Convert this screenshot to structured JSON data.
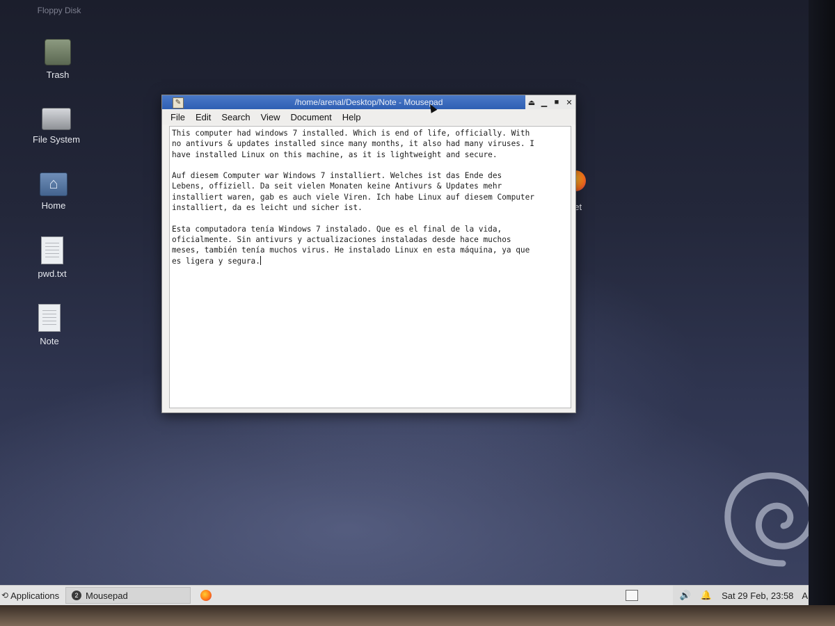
{
  "desktop": {
    "floppy_label": "Floppy Disk",
    "icons": [
      {
        "label": "Trash",
        "icon": "trash-icon"
      },
      {
        "label": "File System",
        "icon": "drive-icon"
      },
      {
        "label": "Home",
        "icon": "home-folder-icon"
      },
      {
        "label": "pwd.txt",
        "icon": "text-file-icon"
      },
      {
        "label": "Note",
        "icon": "text-file-icon"
      }
    ],
    "firefox_partial_label": "net"
  },
  "window": {
    "title": "/home/arenal/Desktop/Note - Mousepad",
    "menu": [
      "File",
      "Edit",
      "Search",
      "View",
      "Document",
      "Help"
    ],
    "content": "This computer had windows 7 installed. Which is end of life, officially. With\nno antivurs & updates installed since many months, it also had many viruses. I\nhave installed Linux on this machine, as it is lightweight and secure.\n\nAuf diesem Computer war Windows 7 installiert. Welches ist das Ende des\nLebens, offiziell. Da seit vielen Monaten keine Antivurs & Updates mehr\ninstalliert waren, gab es auch viele Viren. Ich habe Linux auf diesem Computer\ninstalliert, da es leicht und sicher ist.\n\nEsta computadora tenía Windows 7 instalado. Que es el final de la vida,\noficialmente. Sin antivurs y actualizaciones instaladas desde hace muchos\nmeses, también tenía muchos virus. He instalado Linux en esta máquina, ya que\nes ligera y segura."
  },
  "taskbar": {
    "applications_label": "Applications",
    "task_label": "Mousepad",
    "task_badge": "2",
    "clock": "Sat 29 Feb, 23:58",
    "user": "Arenal"
  },
  "colors": {
    "titlebar": "#2f5fb3",
    "desktop_bg": "#2f3550",
    "taskbar_bg": "#e4e4e4"
  }
}
